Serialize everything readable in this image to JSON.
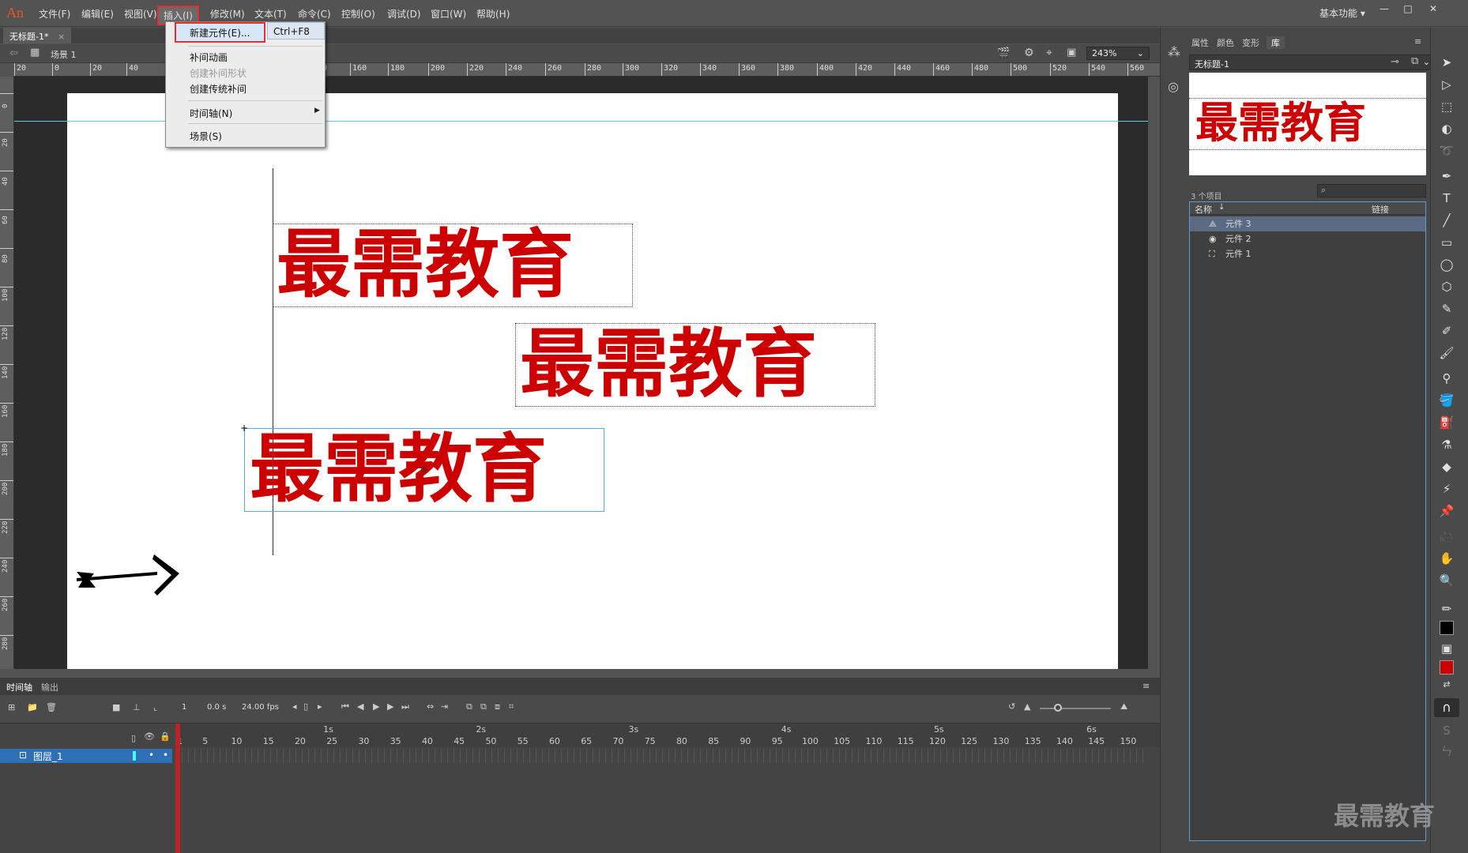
{
  "app": {
    "logo": "An",
    "workspace": "基本功能",
    "window_buttons": {
      "min": "—",
      "max": "□",
      "close": "✕"
    }
  },
  "menubar": {
    "items": [
      "文件(F)",
      "编辑(E)",
      "视图(V)",
      "插入(I)",
      "修改(M)",
      "文本(T)",
      "命令(C)",
      "控制(O)",
      "调试(D)",
      "窗口(W)",
      "帮助(H)"
    ]
  },
  "insert_menu": {
    "items": [
      {
        "label": "新建元件(E)...",
        "shortcut": "Ctrl+F8"
      },
      {
        "label": "补间动画"
      },
      {
        "label": "创建补间形状"
      },
      {
        "label": "创建传统补间"
      },
      {
        "label": "时间轴(N)"
      },
      {
        "label": "场景(S)"
      }
    ]
  },
  "document": {
    "tab_title": "无标题-1*",
    "tab_close": "×",
    "scene": "场景 1",
    "zoom": "243%"
  },
  "ruler": {
    "h": [
      "20",
      "0",
      "20",
      "40",
      "140",
      "160",
      "180",
      "200",
      "220",
      "240",
      "260",
      "280",
      "300",
      "320",
      "340",
      "360",
      "380",
      "400",
      "420",
      "440",
      "460",
      "480",
      "500",
      "520",
      "540",
      "560"
    ],
    "v": [
      "0",
      "20",
      "40",
      "60",
      "80",
      "100",
      "120",
      "140",
      "160",
      "180",
      "200",
      "220",
      "240",
      "260",
      "280"
    ]
  },
  "stage": {
    "texts": [
      "最需教育",
      "最需教育",
      "最需教育"
    ],
    "arrow_color": "#000000",
    "text_color": "#cc0000"
  },
  "panel": {
    "tabs": [
      "属性",
      "颜色",
      "变形",
      "库"
    ],
    "library_doc": "无标题-1",
    "preview_text": "最需教育",
    "item_count": "3 个项目",
    "col_name": "名称",
    "col_link": "链接",
    "items": [
      "元件 3",
      "元件 2",
      "元件 1"
    ]
  },
  "timeline": {
    "tabs": [
      "时间轴",
      "输出"
    ],
    "current_frame": "1",
    "time": "0.0 s",
    "fps": "24.00 fps",
    "seconds": [
      "1s",
      "2s",
      "3s",
      "4s",
      "5s",
      "6s"
    ],
    "frames": [
      "1",
      "5",
      "10",
      "15",
      "20",
      "25",
      "30",
      "35",
      "40",
      "45",
      "50",
      "55",
      "60",
      "65",
      "70",
      "75",
      "80",
      "85",
      "90",
      "95",
      "100",
      "105",
      "110",
      "115",
      "120",
      "125",
      "130",
      "135",
      "140",
      "145",
      "150"
    ],
    "layer_name": "图层_1"
  },
  "watermark": "最需教育"
}
